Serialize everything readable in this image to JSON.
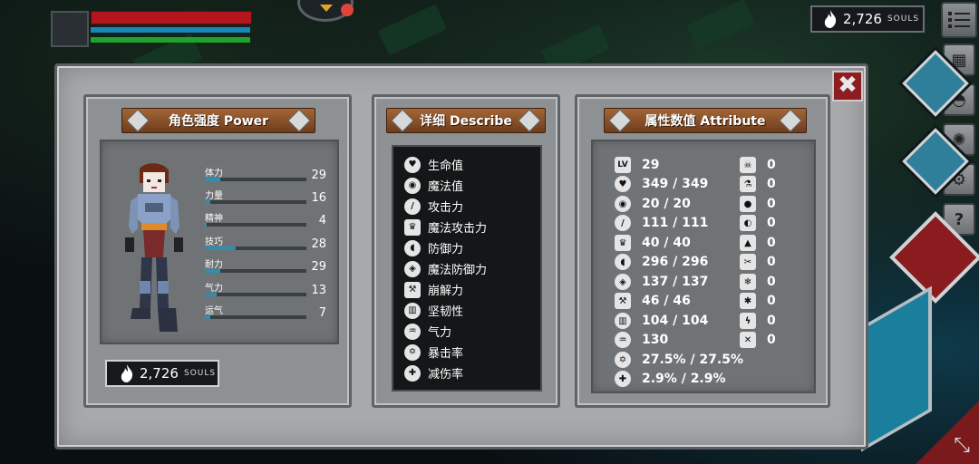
{
  "hud": {
    "souls_value": "2,726",
    "souls_unit": "SOULS"
  },
  "menu": {
    "help_label": "?"
  },
  "panel": {
    "close_symbol": "✖"
  },
  "power": {
    "title": "角色强度 Power",
    "stats": [
      {
        "label": "体力",
        "value": "29",
        "fill": 0.15
      },
      {
        "label": "力量",
        "value": "16",
        "fill": 0.05
      },
      {
        "label": "精神",
        "value": "4",
        "fill": 0.02
      },
      {
        "label": "技巧",
        "value": "28",
        "fill": 0.3
      },
      {
        "label": "耐力",
        "value": "29",
        "fill": 0.15
      },
      {
        "label": "气力",
        "value": "13",
        "fill": 0.12
      },
      {
        "label": "运气",
        "value": "7",
        "fill": 0.05
      }
    ],
    "souls_value": "2,726",
    "souls_unit": "SOULS"
  },
  "describe": {
    "title": "详细 Describe",
    "items": [
      {
        "label": "生命值",
        "icon": "heart-icon"
      },
      {
        "label": "魔法值",
        "icon": "brain-icon"
      },
      {
        "label": "攻击力",
        "icon": "sword-icon"
      },
      {
        "label": "魔法攻击力",
        "icon": "magic-crown-icon"
      },
      {
        "label": "防御力",
        "icon": "shield-icon"
      },
      {
        "label": "魔法防御力",
        "icon": "magic-shield-icon"
      },
      {
        "label": "崩解力",
        "icon": "hammer-icon"
      },
      {
        "label": "坚韧性",
        "icon": "helmet-icon"
      },
      {
        "label": "气力",
        "icon": "lungs-icon"
      },
      {
        "label": "暴击率",
        "icon": "star-burst-icon"
      },
      {
        "label": "减伤率",
        "icon": "badge-shield-icon"
      }
    ]
  },
  "attribute": {
    "title": "属性数值 Attribute",
    "level_badge": "LV",
    "left": [
      {
        "icon": "level-icon",
        "value": "29"
      },
      {
        "icon": "heart-icon",
        "value": "349 / 349"
      },
      {
        "icon": "brain-icon",
        "value": "20 / 20"
      },
      {
        "icon": "sword-icon",
        "value": "111 / 111"
      },
      {
        "icon": "magic-crown-icon",
        "value": "40 / 40"
      },
      {
        "icon": "shield-icon",
        "value": "296 / 296"
      },
      {
        "icon": "magic-shield-icon",
        "value": "137 / 137"
      },
      {
        "icon": "hammer-icon",
        "value": "46 / 46"
      },
      {
        "icon": "helmet-icon",
        "value": "104 / 104"
      },
      {
        "icon": "lungs-icon",
        "value": "130"
      },
      {
        "icon": "star-burst-icon",
        "value": "27.5% / 27.5%"
      },
      {
        "icon": "badge-shield-icon",
        "value": "2.9% / 2.9%"
      }
    ],
    "right": [
      {
        "icon": "skull-icon",
        "value": "0"
      },
      {
        "icon": "poison-icon",
        "value": "0"
      },
      {
        "icon": "water-drop-icon",
        "value": "0"
      },
      {
        "icon": "bleed-icon",
        "value": "0"
      },
      {
        "icon": "fire-icon",
        "value": "0"
      },
      {
        "icon": "cut-icon",
        "value": "0"
      },
      {
        "icon": "frost-icon",
        "value": "0"
      },
      {
        "icon": "ice-icon",
        "value": "0"
      },
      {
        "icon": "lightning-icon",
        "value": "0"
      },
      {
        "icon": "stab-icon",
        "value": "0"
      }
    ]
  },
  "colors": {
    "hp": "#b3161c",
    "mp": "#1787b8",
    "stamina": "#1fa32d",
    "accent": "#8e1d20"
  }
}
